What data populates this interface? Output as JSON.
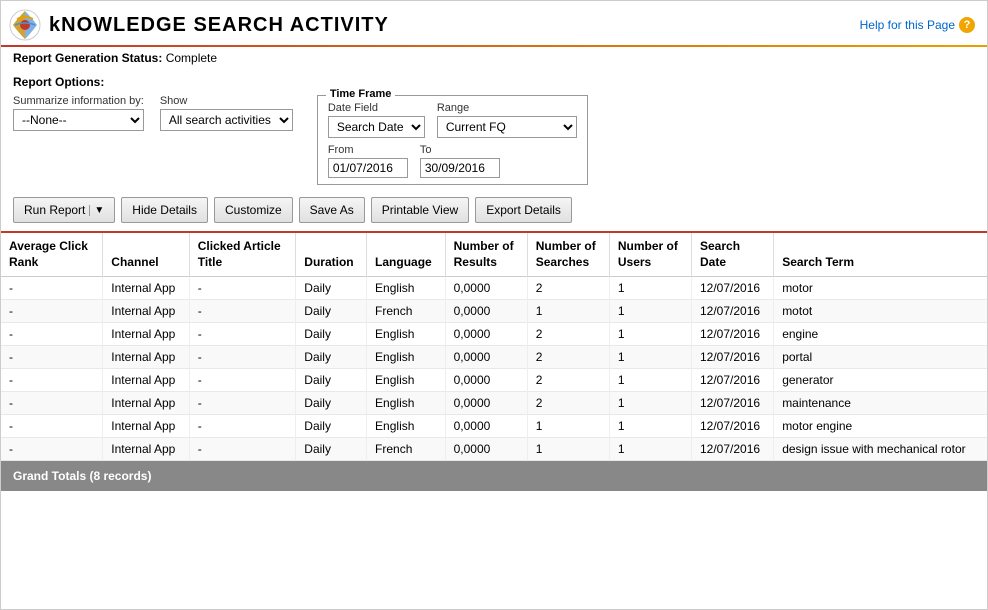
{
  "page": {
    "title": "kNOWLEDGE SEARCH ACTIVITY",
    "help_link": "Help for this Page"
  },
  "report_status": {
    "label": "Report Generation Status:",
    "value": "Complete"
  },
  "report_options": {
    "label": "Report Options:",
    "summarize_label": "Summarize information by:",
    "show_label": "Show",
    "summarize_value": "--None--",
    "show_value": "All search activities",
    "timeframe": {
      "legend": "Time Frame",
      "date_field_label": "Date Field",
      "date_field_value": "Search Date",
      "range_label": "Range",
      "range_value": "Current FQ",
      "from_label": "From",
      "from_value": "01/07/2016",
      "to_label": "To",
      "to_value": "30/09/2016"
    }
  },
  "toolbar": {
    "run_report": "Run Report",
    "hide_details": "Hide Details",
    "customize": "Customize",
    "save_as": "Save As",
    "printable_view": "Printable View",
    "export_details": "Export Details"
  },
  "table": {
    "columns": [
      "Average Click Rank",
      "Channel",
      "Clicked Article Title",
      "Duration",
      "Language",
      "Number of Results",
      "Number of Searches",
      "Number of Users",
      "Search Date",
      "Search Term"
    ],
    "rows": [
      {
        "avg_click_rank": "-",
        "channel": "Internal App",
        "clicked_article": "-",
        "duration": "Daily",
        "language": "English",
        "num_results": "0,0000",
        "num_searches": "2",
        "num_users": "1",
        "search_date": "12/07/2016",
        "search_term": "motor"
      },
      {
        "avg_click_rank": "-",
        "channel": "Internal App",
        "clicked_article": "-",
        "duration": "Daily",
        "language": "French",
        "num_results": "0,0000",
        "num_searches": "1",
        "num_users": "1",
        "search_date": "12/07/2016",
        "search_term": "motot"
      },
      {
        "avg_click_rank": "-",
        "channel": "Internal App",
        "clicked_article": "-",
        "duration": "Daily",
        "language": "English",
        "num_results": "0,0000",
        "num_searches": "2",
        "num_users": "1",
        "search_date": "12/07/2016",
        "search_term": "engine"
      },
      {
        "avg_click_rank": "-",
        "channel": "Internal App",
        "clicked_article": "-",
        "duration": "Daily",
        "language": "English",
        "num_results": "0,0000",
        "num_searches": "2",
        "num_users": "1",
        "search_date": "12/07/2016",
        "search_term": "portal"
      },
      {
        "avg_click_rank": "-",
        "channel": "Internal App",
        "clicked_article": "-",
        "duration": "Daily",
        "language": "English",
        "num_results": "0,0000",
        "num_searches": "2",
        "num_users": "1",
        "search_date": "12/07/2016",
        "search_term": "generator"
      },
      {
        "avg_click_rank": "-",
        "channel": "Internal App",
        "clicked_article": "-",
        "duration": "Daily",
        "language": "English",
        "num_results": "0,0000",
        "num_searches": "2",
        "num_users": "1",
        "search_date": "12/07/2016",
        "search_term": "maintenance"
      },
      {
        "avg_click_rank": "-",
        "channel": "Internal App",
        "clicked_article": "-",
        "duration": "Daily",
        "language": "English",
        "num_results": "0,0000",
        "num_searches": "1",
        "num_users": "1",
        "search_date": "12/07/2016",
        "search_term": "motor engine"
      },
      {
        "avg_click_rank": "-",
        "channel": "Internal App",
        "clicked_article": "-",
        "duration": "Daily",
        "language": "French",
        "num_results": "0,0000",
        "num_searches": "1",
        "num_users": "1",
        "search_date": "12/07/2016",
        "search_term": "design issue with mechanical rotor"
      }
    ],
    "grand_totals": "Grand Totals (8 records)"
  }
}
